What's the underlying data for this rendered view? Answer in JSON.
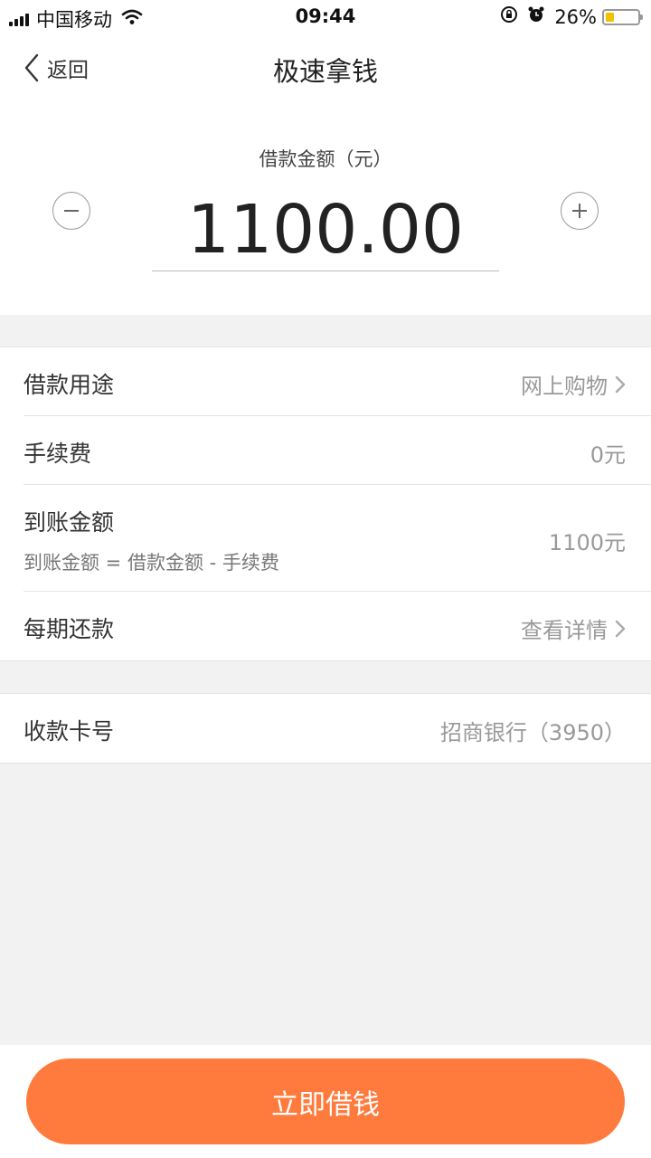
{
  "status_bar": {
    "carrier": "中国移动",
    "time": "09:44",
    "battery_percent": "26%",
    "battery_level": 0.26,
    "battery_color": "#f2c200"
  },
  "nav": {
    "back_label": "返回",
    "title": "极速拿钱"
  },
  "amount": {
    "label": "借款金额（元）",
    "value": "1100.00"
  },
  "details": {
    "purpose_label": "借款用途",
    "purpose_value": "网上购物",
    "fee_label": "手续费",
    "fee_value": "0元",
    "received_label": "到账金额",
    "received_formula": "到账金额 = 借款金额 - 手续费",
    "received_value": "1100元",
    "repay_label": "每期还款",
    "repay_value": "查看详情"
  },
  "card": {
    "label": "收款卡号",
    "value": "招商银行（3950）"
  },
  "cta": {
    "label": "立即借钱",
    "color": "#ff7a3d"
  },
  "icons": [
    "signal-icon",
    "wifi-icon",
    "rotation-lock-icon",
    "alarm-icon",
    "battery-icon",
    "back-chevron-icon",
    "minus-icon",
    "plus-icon",
    "chevron-right-icon"
  ]
}
